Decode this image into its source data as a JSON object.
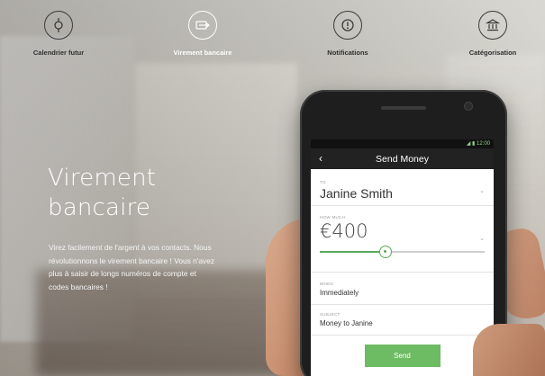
{
  "nav": {
    "items": [
      {
        "label": "Calendrier futur",
        "icon": "calendar-pin-icon"
      },
      {
        "label": "Virement bancaire",
        "icon": "transfer-icon"
      },
      {
        "label": "Notifications",
        "icon": "alert-icon"
      },
      {
        "label": "Catégorisation",
        "icon": "bank-icon"
      }
    ],
    "active_index": 1
  },
  "hero": {
    "title_line1": "Virement",
    "title_line2": "bancaire",
    "description": "Virez facilement de l'argent à vos contacts. Nous révolutionnons le virement bancaire ! Vous n'avez plus à saisir de longs numéros de compte et codes bancaires !"
  },
  "phone": {
    "status_time": "12:00",
    "title": "Send Money",
    "to_label": "TO",
    "to_value": "Janine Smith",
    "amount_label": "HOW MUCH",
    "amount_value": "€400",
    "amount_slider_fraction": 0.4,
    "when_label": "WHEN",
    "when_value": "Immediately",
    "subject_label": "SUBJECT",
    "subject_value": "Money to Janine",
    "send_label": "Send"
  },
  "colors": {
    "accent_green": "#6dbb62",
    "appbar": "#222222"
  }
}
